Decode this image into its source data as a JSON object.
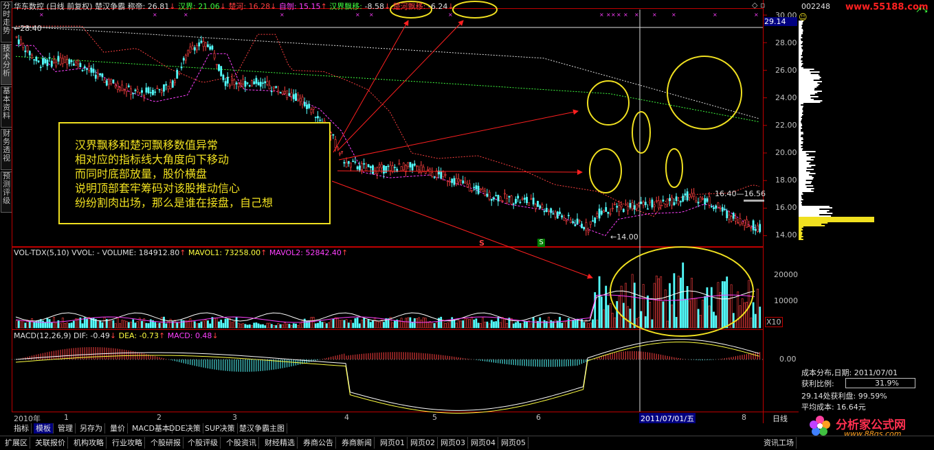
{
  "header": {
    "stock_name": "华东数控",
    "period": "(日线 前复权)",
    "indicator": "楚汉争霸",
    "chenghao_label": "称帝: 26.81",
    "hanjie_label": "汉界: 21.06",
    "chuhe_label": "楚河: 16.28",
    "ziwei_label": "自刎: 15.15",
    "hanjie_drift_label": "汉界飘移:",
    "hanjie_drift_value": "-8.58",
    "chuhe_drift_label": "楚河飘移:",
    "chuhe_drift_value": "-6.24"
  },
  "left_tabs": [
    "分时走势",
    "技术分析",
    "基本资料",
    "财务透视",
    "预测评级"
  ],
  "price_axis": [
    "30.00",
    "28.00",
    "26.00",
    "24.00",
    "22.00",
    "20.00",
    "18.00",
    "16.00",
    "14.00"
  ],
  "current_price_tag": "29.14",
  "price_annotations": {
    "high_left": "28.40",
    "low": "14.00",
    "range": "16.40—16.56"
  },
  "volume_header": {
    "name": "VOL-TDX(5,10) VVOL: -",
    "volume": "VOLUME: 184912.80",
    "mavol1": "MAVOL1: 73258.00",
    "mavol2": "MAVOL2: 52842.40"
  },
  "volume_axis": [
    "20000",
    "10000"
  ],
  "volume_unit": "X10",
  "macd_header": {
    "name": "MACD(12,26,9)",
    "dif": "DIF: -0.49",
    "dea": "DEA: -0.73",
    "macd": "MACD: 0.48"
  },
  "macd_axis": [
    "0.00"
  ],
  "date_axis": {
    "year": "2010年",
    "months": [
      "1",
      "2",
      "3",
      "4",
      "5",
      "6",
      "8"
    ],
    "cursor_date": "2011/07/01/五",
    "period_label": "日线"
  },
  "markers": {
    "s_red": "S",
    "s_green": "S"
  },
  "annotation": [
    "汉界飘移和楚河飘移数值异常",
    "相对应的指标线大角度向下移动",
    "而同时底部放量，股价横盘",
    "说明顶部套牢筹码对该股推动信心",
    "纷纷割肉出场，那么是谁在接盘，自己想"
  ],
  "right_panel": {
    "code": "002248",
    "website": "www.55188.com",
    "cost_title": "成本分布,日期:",
    "cost_date": "2011/07/01",
    "profit_label": "获利比例:",
    "profit_value": "31.9%",
    "profit_at": "29.14处获利盘:",
    "profit_at_value": "99.59%",
    "avg_cost": "平均成本: 16.64元"
  },
  "toolbar_tabs": [
    "指标",
    "模板",
    "管理",
    "另存为",
    "量价",
    "MACD基本",
    "DDE决策",
    "SUP决策",
    "楚汉争霸主图"
  ],
  "bottom_tabs": [
    "扩展区",
    "关联报价",
    "机构攻略",
    "行业攻略",
    "个股研报",
    "个股评级",
    "个股资讯",
    "财经精选",
    "券商公告",
    "券商新闻",
    "网页01",
    "网页02",
    "网页03",
    "网页04",
    "网页05",
    "资讯工场"
  ],
  "logo": {
    "title": "分析家公式网",
    "url": "www.88gs.com"
  },
  "colors": {
    "up": "#ff4040",
    "down": "#54ffff",
    "accent": "#f0e020",
    "axis": "#c00000"
  }
}
